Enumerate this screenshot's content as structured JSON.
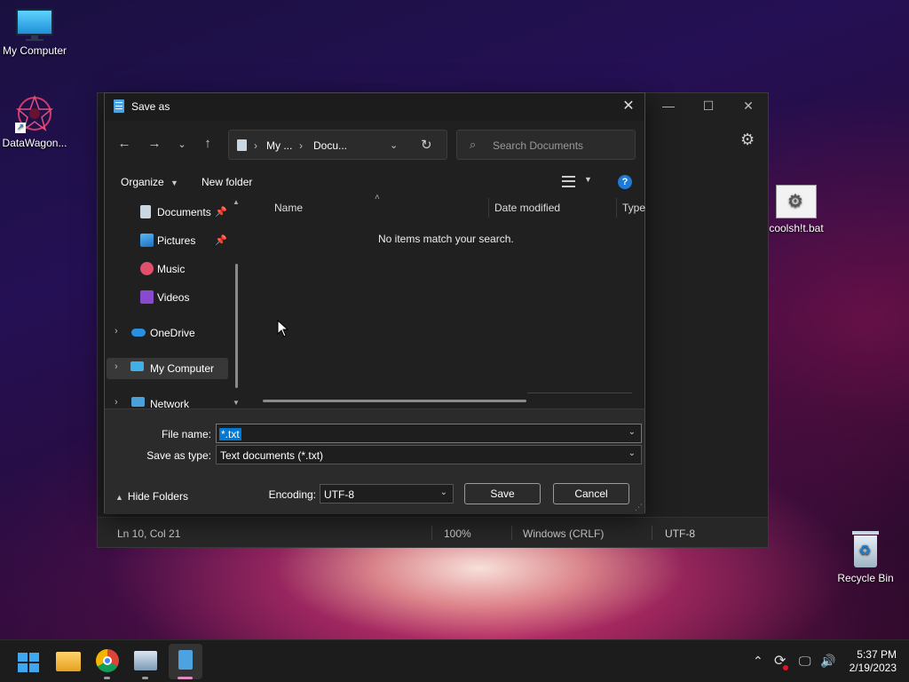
{
  "desktop": {
    "icons": [
      {
        "label": "My Computer"
      },
      {
        "label": "DataWagon..."
      },
      {
        "label": "coolsh!t.bat"
      },
      {
        "label": "Recycle Bin"
      }
    ]
  },
  "notepad": {
    "status": {
      "position": "Ln 10, Col 21",
      "zoom": "100%",
      "line_ending": "Windows (CRLF)",
      "encoding": "UTF-8"
    }
  },
  "dialog": {
    "title": "Save as",
    "close_glyph": "✕",
    "address": {
      "segment1": "My ...",
      "segment2": "Docu..."
    },
    "search": {
      "placeholder": "Search Documents"
    },
    "toolbar": {
      "organize": "Organize",
      "new_folder": "New folder",
      "help": "?"
    },
    "nav": {
      "documents": "Documents",
      "pictures": "Pictures",
      "music": "Music",
      "videos": "Videos",
      "onedrive": "OneDrive",
      "my_computer": "My Computer",
      "network": "Network"
    },
    "columns": {
      "name": "Name",
      "date_modified": "Date modified",
      "type": "Type"
    },
    "empty_message": "No items match your search.",
    "file_name": {
      "label": "File name:",
      "value": "*.txt"
    },
    "save_type": {
      "label": "Save as type:",
      "value": "Text documents (*.txt)"
    },
    "hide_folders": "Hide Folders",
    "encoding": {
      "label": "Encoding:",
      "value": "UTF-8"
    },
    "save_button": "Save",
    "cancel_button": "Cancel"
  },
  "taskbar": {
    "clock": {
      "time": "5:37 PM",
      "date": "2/19/2023"
    }
  },
  "colors": {
    "accent": "#0078d4",
    "dialog_bg": "#202020",
    "bottom_bg": "#2b2b2b"
  }
}
